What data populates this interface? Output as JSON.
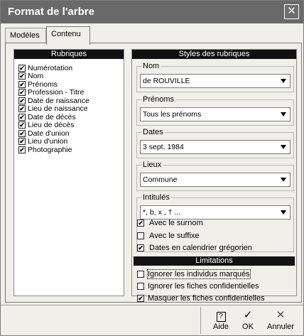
{
  "window": {
    "title": "Format de l'arbre",
    "close_glyph": "✕"
  },
  "tabs": [
    {
      "label": "Modèles",
      "active": false
    },
    {
      "label": "Contenu",
      "active": true
    }
  ],
  "rubriques": {
    "header": "Rubriques",
    "items": [
      {
        "label": "Numérotation",
        "checked": true
      },
      {
        "label": "Nom",
        "checked": true
      },
      {
        "label": "Prénoms",
        "checked": true
      },
      {
        "label": "Profession - Titre",
        "checked": true
      },
      {
        "label": "Date de naissance",
        "checked": true
      },
      {
        "label": "Lieu de naissance",
        "checked": true
      },
      {
        "label": "Date de décès",
        "checked": true
      },
      {
        "label": "Lieu de décès",
        "checked": true
      },
      {
        "label": "Date d'union",
        "checked": true
      },
      {
        "label": "Lieu d'union",
        "checked": true
      },
      {
        "label": "Photographie",
        "checked": true
      }
    ]
  },
  "styles": {
    "header": "Styles des rubriques",
    "nom": {
      "label": "Nom",
      "value": "de ROUVILLE"
    },
    "prenoms": {
      "label": "Prénoms",
      "value": "Tous les prénoms"
    },
    "dates": {
      "label": "Dates",
      "value": "3 sept. 1984"
    },
    "lieux": {
      "label": "Lieux",
      "value": "Commune"
    },
    "intitules": {
      "label": "Intitulés",
      "value": "*, b, x , † ..."
    },
    "options": [
      {
        "label": "Avec le surnom",
        "checked": true
      },
      {
        "label": "Avec le suffixe",
        "checked": false
      },
      {
        "label": "Dates en calendrier grégorien",
        "checked": true
      }
    ]
  },
  "limitations": {
    "header": "Limitations",
    "items": [
      {
        "label": "Ignorer les individus marqués",
        "checked": false
      },
      {
        "label": "Ignorer les fiches confidentielles",
        "checked": false
      },
      {
        "label": "Masquer les fiches confidentielles",
        "checked": true
      }
    ]
  },
  "footer": {
    "aide": {
      "label": "Aide",
      "icon": "?"
    },
    "ok": {
      "label": "OK",
      "icon": "✓"
    },
    "annuler": {
      "label": "Annuler",
      "icon": "✕"
    }
  },
  "check_glyph": "✔"
}
